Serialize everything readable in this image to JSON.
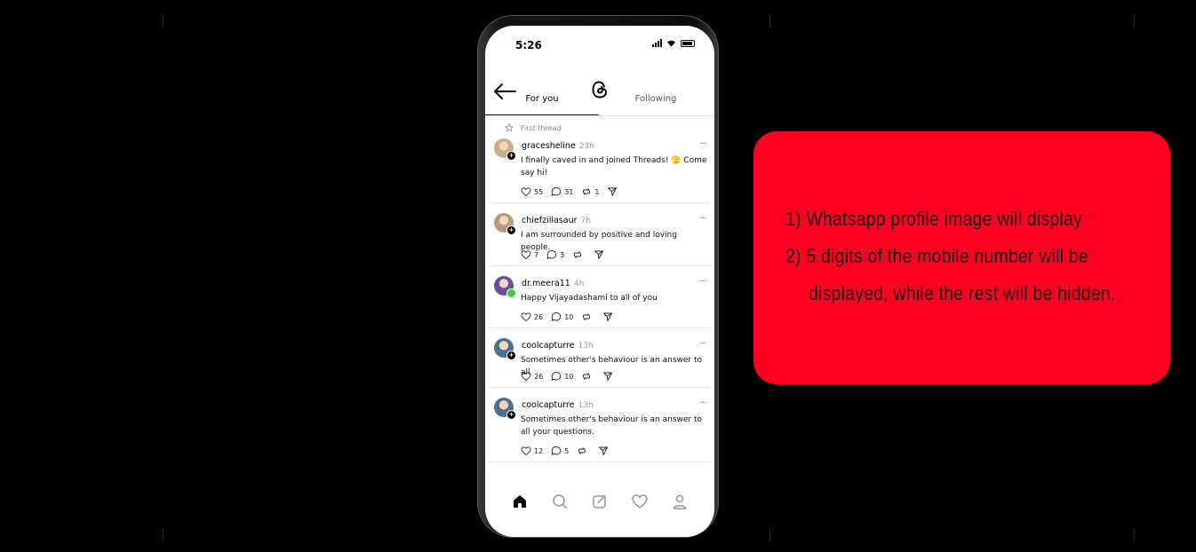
{
  "status_bar": {
    "time": "5:26"
  },
  "tabs": {
    "for_you": "For you",
    "following": "Following"
  },
  "feed": {
    "first_thread_label": "First thread",
    "posts": [
      {
        "username": "gracesheline",
        "time": "23h",
        "text": "I finally caved in and joined Threads! 🫣 Come say hi!",
        "likes": "55",
        "replies": "31",
        "reposts": "1",
        "avatar_color": "#c9b08a"
      },
      {
        "username": "chiefzillasaur",
        "time": "7h",
        "text": "I am surrounded by positive and loving people.",
        "likes": "7",
        "replies": "3",
        "reposts": "",
        "avatar_color": "#b89c7a"
      },
      {
        "username": "dr.meera11",
        "time": "4h",
        "text": "Happy Vijayadashami to all of you",
        "likes": "26",
        "replies": "10",
        "reposts": "",
        "avatar_color": "#6a4c9c"
      },
      {
        "username": "coolcapturre",
        "time": "13h",
        "text": "Sometimes other's behaviour is an answer to all",
        "likes": "26",
        "replies": "10",
        "reposts": "",
        "avatar_color": "#4f6f8f"
      },
      {
        "username": "coolcapturre",
        "time": "13h",
        "text": "Sometimes other's behaviour is an answer to all your questions.",
        "likes": "12",
        "replies": "5",
        "reposts": "",
        "avatar_color": "#4f6f8f"
      }
    ]
  },
  "bottom_nav": [
    "home-icon",
    "search-icon",
    "compose-icon",
    "heart-icon",
    "profile-icon"
  ],
  "note": {
    "line1": "1) Whatsapp profile image will display",
    "line2": "2) 5 digits of the mobile number will be",
    "line3": "displayed, while the rest will be hidden."
  },
  "colors": {
    "note_background": "#ff0022",
    "page_background": "#000000"
  }
}
